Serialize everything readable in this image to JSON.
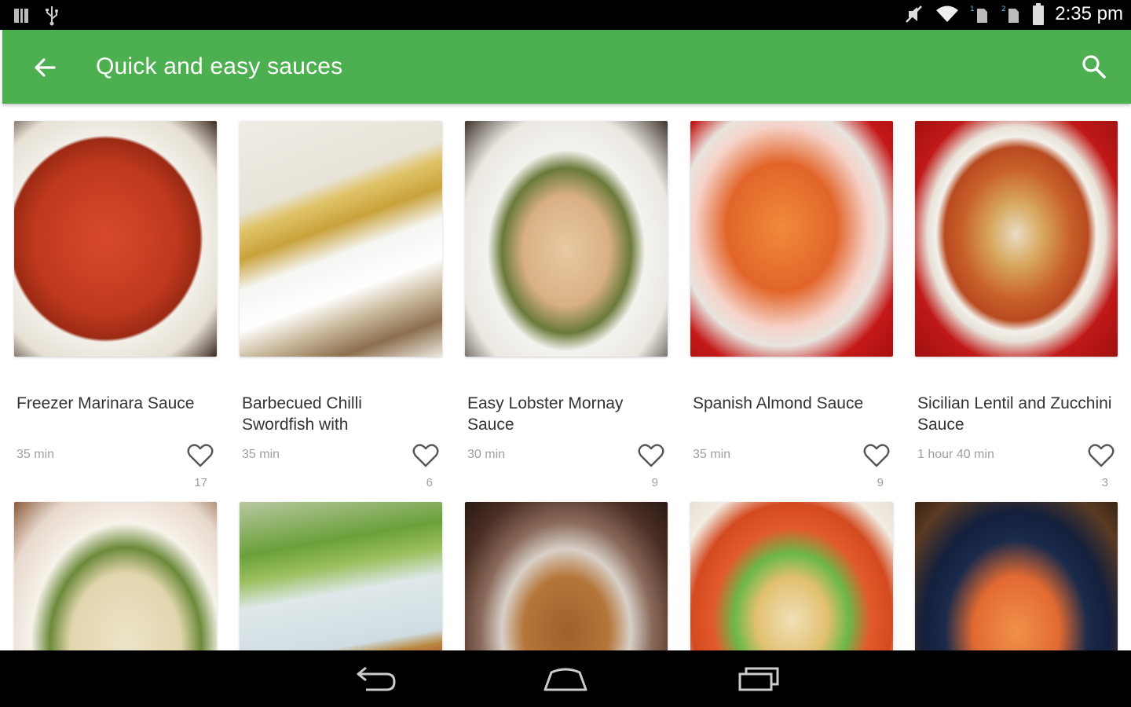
{
  "status_bar": {
    "time": "2:35 pm"
  },
  "app_bar": {
    "title": "Quick and easy sauces",
    "color": "#4caf50"
  },
  "recipes": [
    {
      "name": "Freezer Marinara Sauce",
      "time": "35 min",
      "likes": "17",
      "image": "tomato-sauce-bowl"
    },
    {
      "name": "Barbecued Chilli Swordfish with",
      "time": "35 min",
      "likes": "6",
      "image": "swordfish-with-yogurt-sauce"
    },
    {
      "name": "Easy Lobster Mornay Sauce",
      "time": "30 min",
      "likes": "9",
      "image": "lobster-mornay-pasta"
    },
    {
      "name": "Spanish Almond Sauce",
      "time": "35 min",
      "likes": "9",
      "image": "shrimp-almond-sauce"
    },
    {
      "name": "Sicilian Lentil and Zucchini Sauce",
      "time": "1 hour 40 min",
      "likes": "3",
      "image": "lentil-pasta-bowl"
    },
    {
      "name": "",
      "time": "",
      "likes": "",
      "image": "creamy-mushroom-pasta"
    },
    {
      "name": "",
      "time": "",
      "likes": "",
      "image": "yogurt-dip-pita"
    },
    {
      "name": "",
      "time": "",
      "likes": "",
      "image": "gravy-glass-bowl"
    },
    {
      "name": "",
      "time": "",
      "likes": "",
      "image": "pasta-peas-parmesan"
    },
    {
      "name": "",
      "time": "",
      "likes": "",
      "image": "farfalle-tomato-cream"
    }
  ]
}
